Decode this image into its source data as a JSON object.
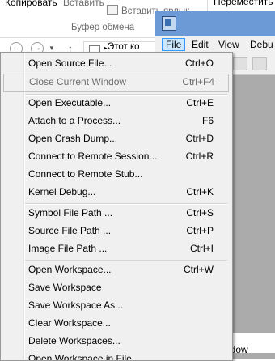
{
  "explorer": {
    "ribbon": {
      "copy_label": "Копировать",
      "paste_label": "Вставить",
      "paste_shortcut_label": "Вставить ярлык",
      "clipboard_group_label": "Буфер обмена",
      "move_to_label": "Переместить в"
    },
    "address_text": "Этот ко"
  },
  "windbg": {
    "menubar": [
      {
        "label": "File"
      },
      {
        "label": "Edit"
      },
      {
        "label": "View"
      },
      {
        "label": "Debu"
      }
    ],
    "status_text": "ndow"
  },
  "file_menu": {
    "items": [
      {
        "label": "Open Source File...",
        "shortcut": "Ctrl+O"
      },
      {
        "label": "Close Current Window",
        "shortcut": "Ctrl+F4",
        "disabled": true
      },
      {
        "label": "Open Executable...",
        "shortcut": "Ctrl+E"
      },
      {
        "label": "Attach to a Process...",
        "shortcut": "F6"
      },
      {
        "label": "Open Crash Dump...",
        "shortcut": "Ctrl+D"
      },
      {
        "label": "Connect to Remote Session...",
        "shortcut": "Ctrl+R"
      },
      {
        "label": "Connect to Remote Stub...",
        "shortcut": ""
      },
      {
        "label": "Kernel Debug...",
        "shortcut": "Ctrl+K"
      },
      {
        "label": "Symbol File Path ...",
        "shortcut": "Ctrl+S"
      },
      {
        "label": "Source File Path ...",
        "shortcut": "Ctrl+P"
      },
      {
        "label": "Image File Path ...",
        "shortcut": "Ctrl+I"
      },
      {
        "label": "Open Workspace...",
        "shortcut": "Ctrl+W"
      },
      {
        "label": "Save Workspace",
        "shortcut": ""
      },
      {
        "label": "Save Workspace As...",
        "shortcut": ""
      },
      {
        "label": "Clear Workspace...",
        "shortcut": ""
      },
      {
        "label": "Delete Workspaces...",
        "shortcut": ""
      },
      {
        "label": "Open Workspace in File...",
        "shortcut": ""
      }
    ]
  },
  "colors": {
    "menu_bg": "#f0f0f0",
    "menu_active_border": "#3399ff",
    "menu_active_bg": "#cce8ff",
    "disabled_text": "#6d6d6d",
    "window_accent": "#6b9ad6"
  }
}
